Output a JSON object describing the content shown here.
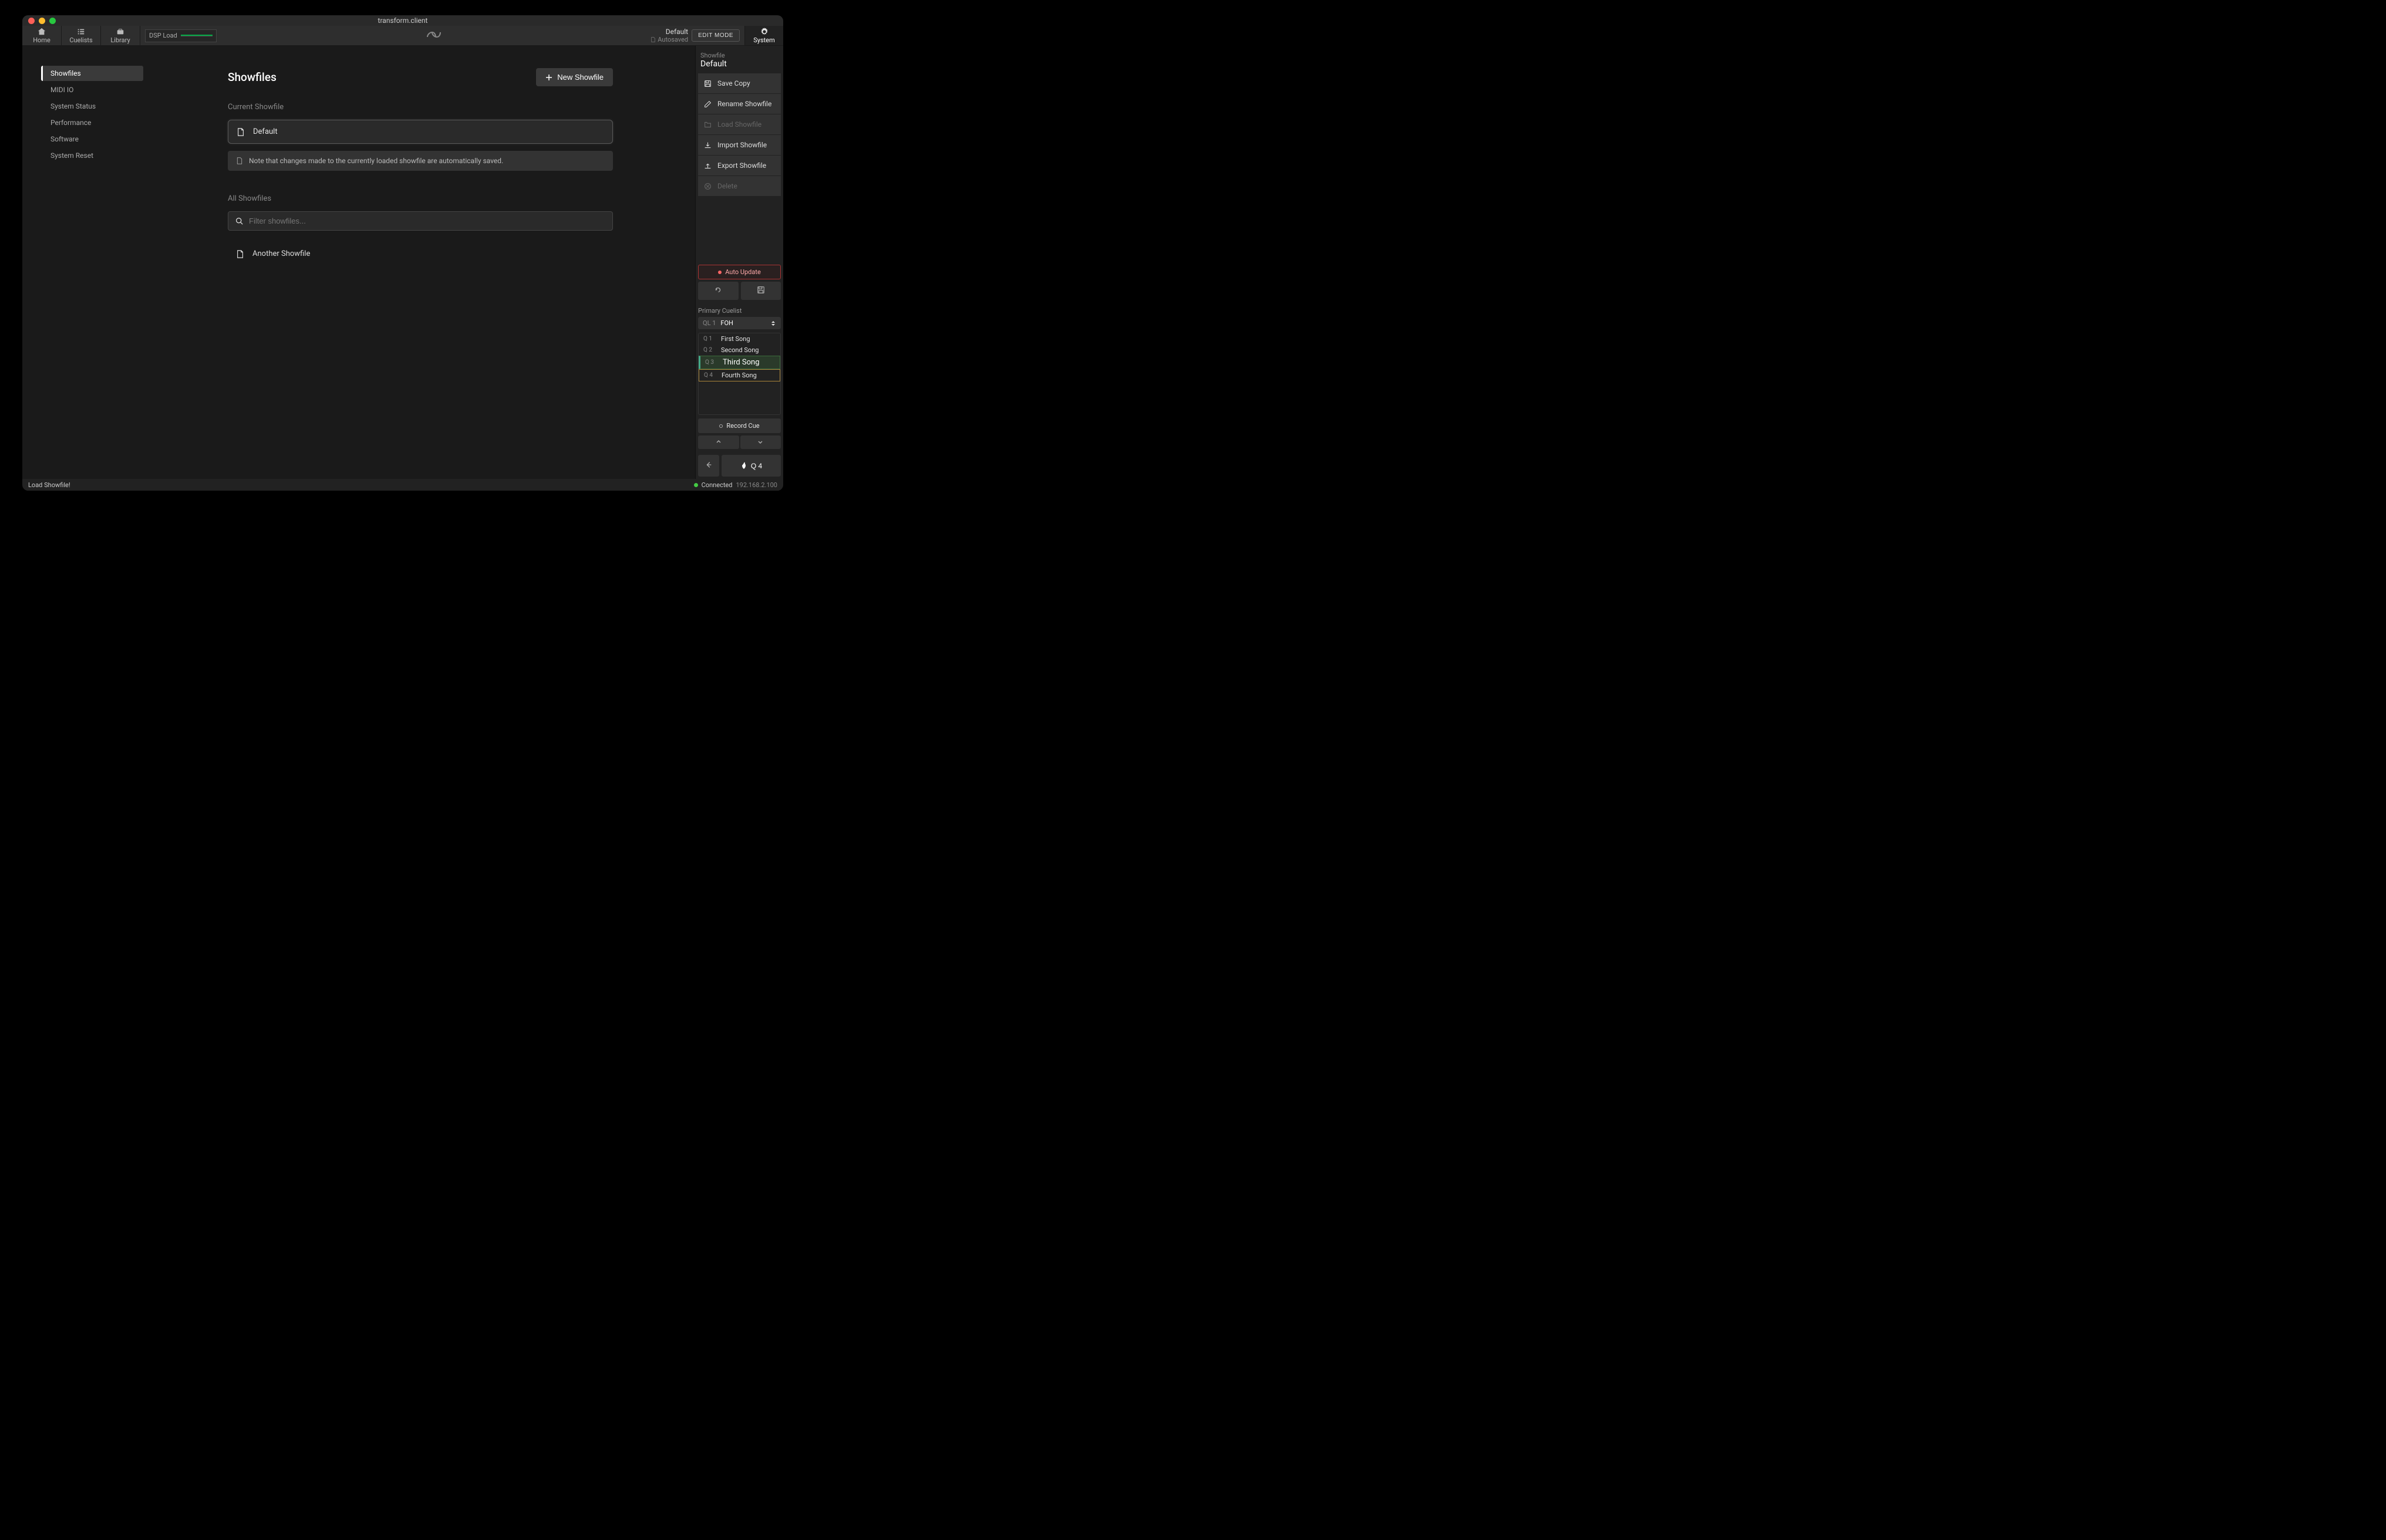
{
  "window": {
    "title": "transform.client"
  },
  "topbar": {
    "tabs": {
      "home": "Home",
      "cuelists": "Cuelists",
      "library": "Library"
    },
    "dsp_label": "DSP Load",
    "showfile_name": "Default",
    "autosaved": "Autosaved",
    "edit_mode": "EDIT MODE",
    "system": "System"
  },
  "sidebar": {
    "items": [
      "Showfiles",
      "MIDI IO",
      "System Status",
      "Performance",
      "Software",
      "System Reset"
    ]
  },
  "main": {
    "title": "Showfiles",
    "new_button": "New Showfile",
    "current_label": "Current Showfile",
    "current_name": "Default",
    "note": "Note that changes made to the currently loaded showfile are automatically saved.",
    "all_label": "All Showfiles",
    "filter_placeholder": "Filter showfiles...",
    "items": [
      "Another Showfile"
    ]
  },
  "right_panel": {
    "title_label": "Showfile",
    "name": "Default",
    "actions": {
      "save_copy": "Save Copy",
      "rename": "Rename Showfile",
      "load": "Load Showfile",
      "import": "Import Showfile",
      "export": "Export Showfile",
      "delete": "Delete"
    },
    "auto_update": "Auto Update",
    "primary_cuelist_label": "Primary Cuelist",
    "cuelist": {
      "ql": "QL 1",
      "name": "FOH"
    },
    "cues": [
      {
        "q": "Q 1",
        "name": "First Song"
      },
      {
        "q": "Q 2",
        "name": "Second Song"
      },
      {
        "q": "Q 3",
        "name": "Third Song"
      },
      {
        "q": "Q 4",
        "name": "Fourth Song"
      }
    ],
    "record_cue": "Record Cue",
    "go_label": "Q 4"
  },
  "statusbar": {
    "message": "Load Showfile!",
    "connected": "Connected",
    "ip": "192.168.2.100"
  }
}
